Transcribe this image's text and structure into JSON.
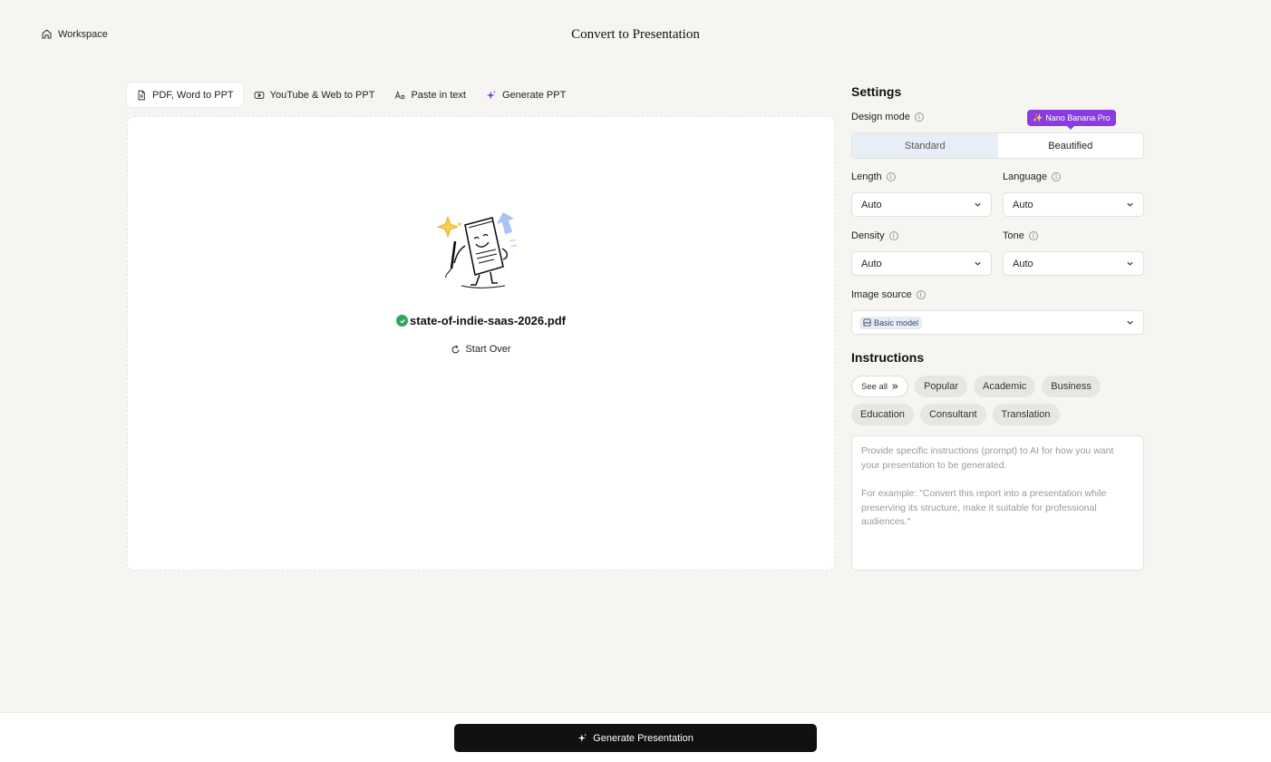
{
  "header": {
    "workspace_label": "Workspace",
    "title": "Convert to Presentation"
  },
  "tabs": [
    {
      "label": "PDF, Word to PPT",
      "icon": "document-icon",
      "active": true
    },
    {
      "label": "YouTube & Web to PPT",
      "icon": "youtube-icon",
      "active": false
    },
    {
      "label": "Paste in text",
      "icon": "text-icon",
      "active": false
    },
    {
      "label": "Generate PPT",
      "icon": "sparkle-icon",
      "active": false
    }
  ],
  "upload": {
    "filename": "state-of-indie-saas-2026.pdf",
    "start_over_label": "Start Over"
  },
  "settings": {
    "title": "Settings",
    "design_mode": {
      "label": "Design mode",
      "options": [
        "Standard",
        "Beautified"
      ],
      "selected": "Beautified",
      "badge": "Nano Banana Pro"
    },
    "length": {
      "label": "Length",
      "value": "Auto"
    },
    "language": {
      "label": "Language",
      "value": "Auto"
    },
    "density": {
      "label": "Density",
      "value": "Auto"
    },
    "tone": {
      "label": "Tone",
      "value": "Auto"
    },
    "image_source": {
      "label": "Image source",
      "value": "Basic model"
    }
  },
  "instructions": {
    "title": "Instructions",
    "see_all_label": "See all",
    "chips": [
      "Popular",
      "Academic",
      "Business",
      "Education",
      "Consultant",
      "Translation"
    ],
    "placeholder_line1": "Provide specific instructions (prompt) to AI for how you want your presentation to be generated.",
    "placeholder_line2": "For example: \"Convert this report into a presentation while preserving its structure, make it suitable for professional audiences.\""
  },
  "footer": {
    "generate_label": "Generate Presentation"
  },
  "colors": {
    "background": "#f6f5f1",
    "accent_purple": "#8b3ce0",
    "success_green": "#2ea65a",
    "primary_button": "#111111"
  }
}
